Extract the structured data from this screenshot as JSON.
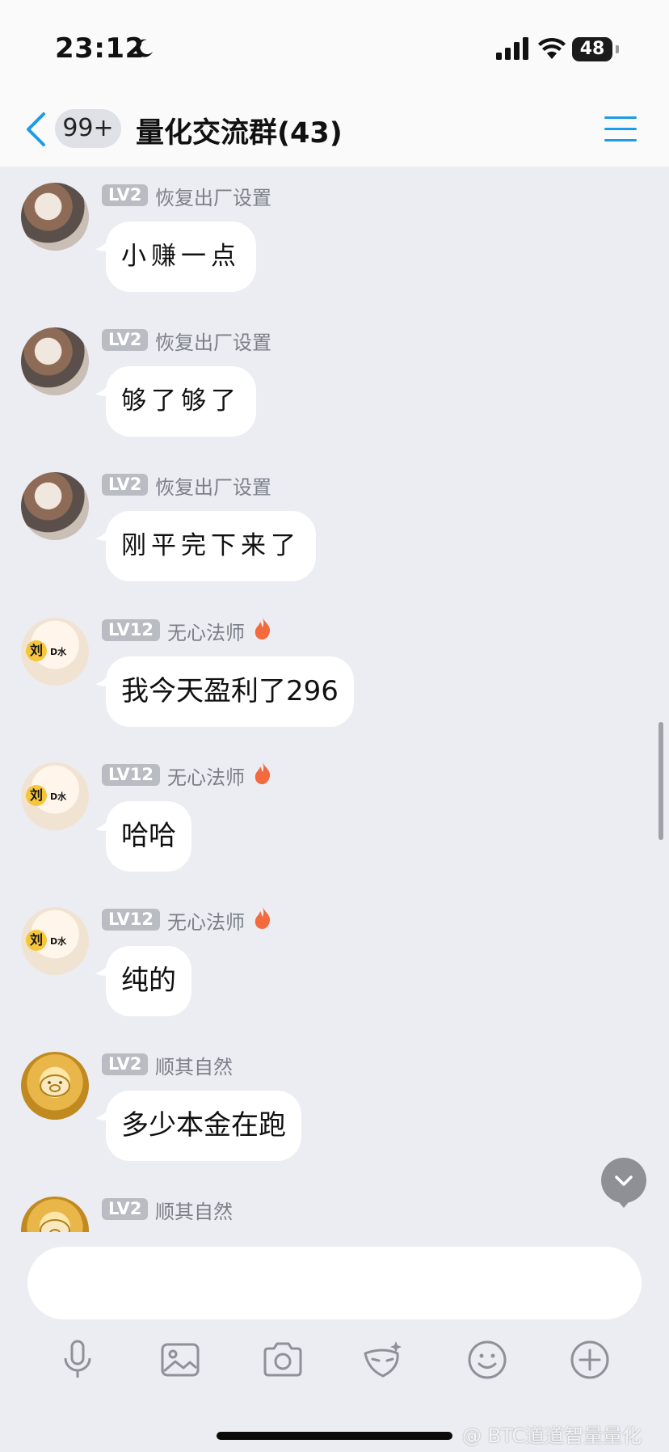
{
  "status": {
    "time": "23:12",
    "battery": "48"
  },
  "header": {
    "unread_badge": "99+",
    "title": "量化交流群(43)"
  },
  "messages": [
    {
      "level": "LV2",
      "sender": "恢复出厂设置",
      "text": "小赚一点",
      "fire": false
    },
    {
      "level": "LV2",
      "sender": "恢复出厂设置",
      "text": "够了够了",
      "fire": false
    },
    {
      "level": "LV2",
      "sender": "恢复出厂设置",
      "text": "刚平完下来了",
      "fire": false
    },
    {
      "level": "LV12",
      "sender": "无心法师",
      "text": "我今天盈利了296",
      "fire": true
    },
    {
      "level": "LV12",
      "sender": "无心法师",
      "text": "哈哈",
      "fire": true
    },
    {
      "level": "LV12",
      "sender": "无心法师",
      "text": "纯的",
      "fire": true
    },
    {
      "level": "LV2",
      "sender": "顺其自然",
      "text": "多少本金在跑",
      "fire": false
    },
    {
      "level": "LV2",
      "sender": "顺其自然",
      "text": "",
      "fire": false
    }
  ],
  "avatar_text": {
    "liu": "刘",
    "dshui": "D水"
  },
  "input": {
    "placeholder": ""
  },
  "toolbar": [
    "microphone-icon",
    "image-icon",
    "camera-icon",
    "mask-icon",
    "emoji-icon",
    "plus-icon"
  ],
  "watermark": "@ BTC道道智量量化",
  "colors": {
    "accent": "#1c9bea",
    "background": "#ebedf2",
    "bubble": "#ffffff",
    "level_badge": "#b9bcc3",
    "fire": "#f26a3d"
  }
}
